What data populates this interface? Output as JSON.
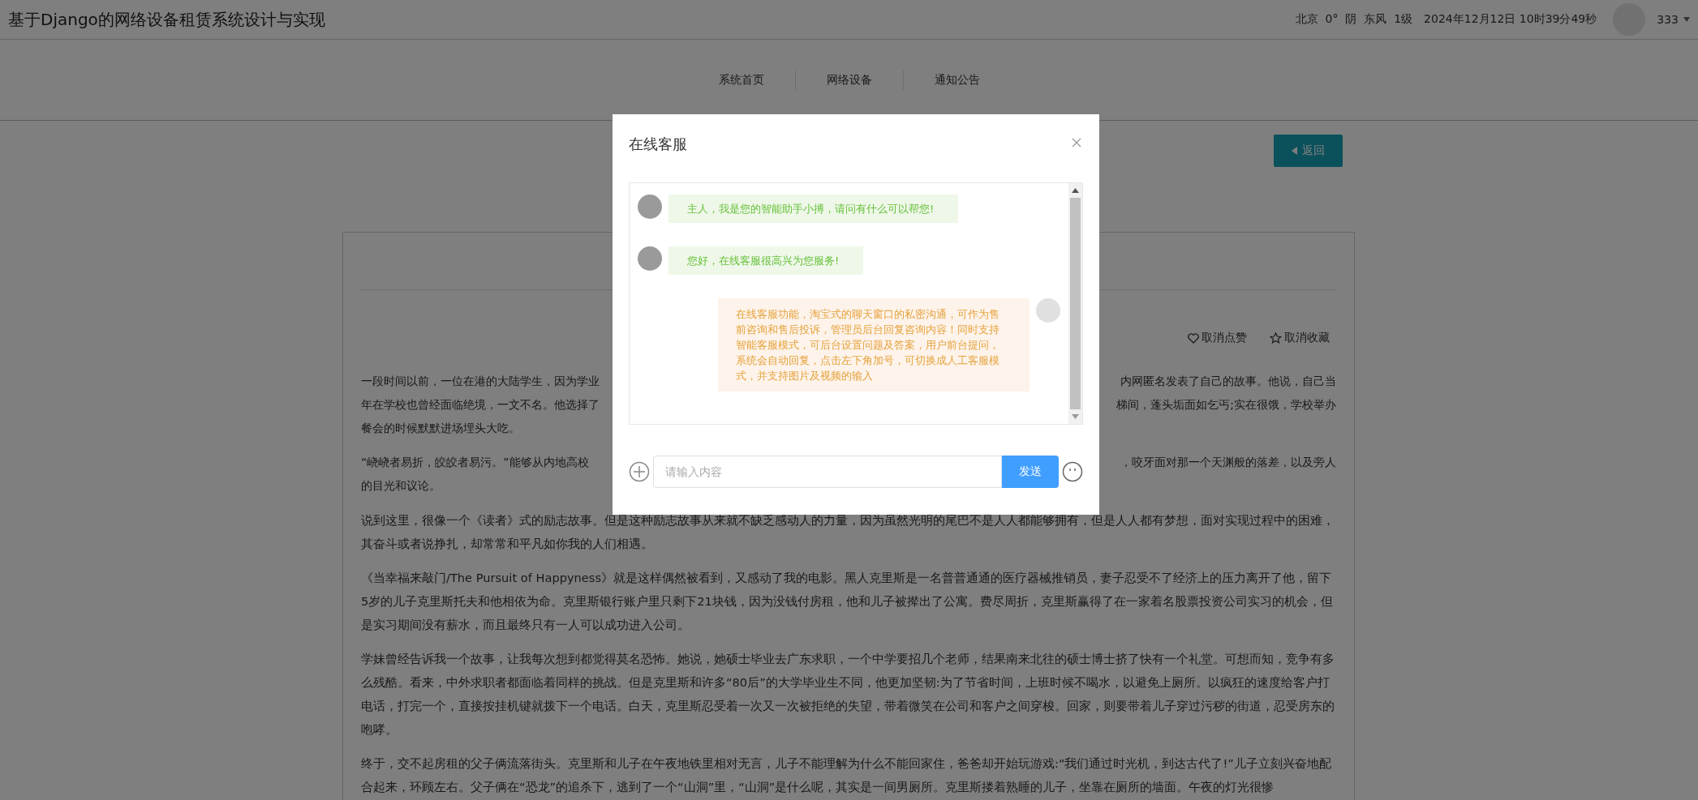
{
  "header": {
    "title": "基于Django的网络设备租赁系统设计与实现",
    "weather": "北京  0°  阴  东风  1级",
    "datetime": "2024年12月12日 10时39分49秒",
    "username": "333"
  },
  "nav": [
    {
      "label": "系统首页"
    },
    {
      "label": "网络设备"
    },
    {
      "label": "通知公告"
    }
  ],
  "back_button": "返回",
  "article": {
    "actions": [
      {
        "kind": "like",
        "label": "取消点赞"
      },
      {
        "kind": "favorite",
        "label": "取消收藏"
      }
    ],
    "paragraphs": [
      {
        "kind": "obscured",
        "lines": [
          {
            "left": "一段时间以前，一位在港的大陆学生，因为学业",
            "right": "内网匿名发表了自己的故事。他说，自己当"
          },
          {
            "left": "年在学校也曾经面临绝境，一文不名。他选择了",
            "right": "梯间，蓬头垢面如乞丐;实在很饿，学校举办"
          },
          {
            "left": "餐会的时候默默进场埋头大吃。"
          }
        ]
      },
      {
        "kind": "obscured",
        "lines": [
          {
            "left": "“峣峣者易折，皎皎者易污。”能够从内地高校",
            "right": "，咬牙面对那一个天渊般的落差，以及旁人"
          },
          {
            "left": "的目光和议论。"
          }
        ]
      },
      {
        "kind": "text",
        "text": "说到这里，很像一个《读者》式的励志故事。但是这种励志故事从来就不缺乏感动人的力量，因为虽然光明的尾巴不是人人都能够拥有，但是人人都有梦想，面对实现过程中的困难，其奋斗或者说挣扎，却常常和平凡如你我的人们相遇。"
      },
      {
        "kind": "text",
        "text": "《当幸福来敲门/The Pursuit of Happyness》就是这样偶然被看到，又感动了我的电影。黑人克里斯是一名普普通通的医疗器械推销员，妻子忍受不了经济上的压力离开了他，留下5岁的儿子克里斯托夫和他相依为命。克里斯银行账户里只剩下21块钱，因为没钱付房租，他和儿子被撵出了公寓。费尽周折，克里斯赢得了在一家着名股票投资公司实习的机会，但是实习期间没有薪水，而且最终只有一人可以成功进入公司。"
      },
      {
        "kind": "text",
        "text": "学妹曾经告诉我一个故事，让我每次想到都觉得莫名恐怖。她说，她硕士毕业去广东求职，一个中学要招几个老师，结果南来北往的硕士博士挤了快有一个礼堂。可想而知，竞争有多么残酷。看来，中外求职者都面临着同样的挑战。但是克里斯和许多“80后”的大学毕业生不同，他更加坚韧:为了节省时间，上班时候不喝水，以避免上厕所。以疯狂的速度给客户打电话，打完一个，直接按挂机键就拨下一个电话。白天，克里斯忍受着一次又一次被拒绝的失望，带着微笑在公司和客户之间穿梭。回家，则要带着儿子穿过污秽的街道，忍受房东的咆哮。"
      },
      {
        "kind": "text",
        "text": "终于，交不起房租的父子俩流落街头。克里斯和儿子在午夜地铁里相对无言，儿子不能理解为什么不能回家住，爸爸却开始玩游戏:“我们通过时光机，到达古代了!”儿子立刻兴奋地配合起来，环顾左右。父子俩在“恐龙”的追杀下，逃到了一个“山洞”里，“山洞”是什么呢，其实是一间男厕所。克里斯搂着熟睡的儿子，坐靠在厕所的墙面。午夜的灯光很惨"
      }
    ]
  },
  "dialog": {
    "title": "在线客服",
    "messages": [
      {
        "kind": "bot",
        "text": "主人，我是您的智能助手小搏，请问有什么可以帮您!"
      },
      {
        "kind": "bot",
        "text": "您好，在线客服很高兴为您服务!"
      },
      {
        "kind": "user",
        "text": "在线客服功能，淘宝式的聊天窗口的私密沟通，可作为售前咨询和售后投诉，管理员后台回复咨询内容！同时支持智能客服模式，可后台设置问题及答案，用户前台提问，系统会自动回复，点击左下角加号，可切换成人工客服模式，并支持图片及视频的输入"
      }
    ],
    "input": {
      "placeholder": "请输入内容"
    },
    "send_button": "发送"
  }
}
